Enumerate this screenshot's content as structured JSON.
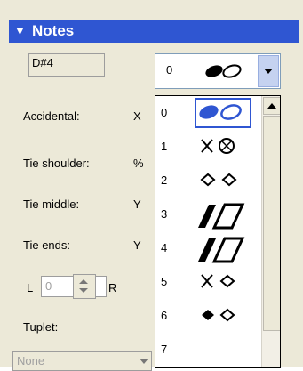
{
  "panel": {
    "title": "Notes",
    "collapse_glyph": "▼"
  },
  "note_value": "D#4",
  "labels": {
    "accidental": "Accidental:",
    "accidental_val": "X",
    "tie_shoulder": "Tie shoulder:",
    "tie_shoulder_val": "%",
    "tie_middle": "Tie middle:",
    "tie_middle_val": "Y",
    "tie_ends": "Tie ends:",
    "tie_ends_val": "Y",
    "l": "L",
    "r": "R",
    "tuplet": "Tuplet:"
  },
  "spin_value": "0",
  "tuplet_select": "None",
  "dropdown": {
    "selected_value": "0",
    "icon": "notehead-pair-icon"
  },
  "list_items": [
    {
      "n": "0",
      "icon": "filled-hollow-oval-icon"
    },
    {
      "n": "1",
      "icon": "x-and-circle-x-icon"
    },
    {
      "n": "2",
      "icon": "diamond-pair-icon"
    },
    {
      "n": "3",
      "icon": "slash-notehead-icon"
    },
    {
      "n": "4",
      "icon": "slash-notehead-icon"
    },
    {
      "n": "5",
      "icon": "x-and-diamond-icon"
    },
    {
      "n": "6",
      "icon": "filled-diamond-and-diamond-icon"
    },
    {
      "n": "7",
      "icon": ""
    }
  ],
  "colors": {
    "header": "#2f56d2",
    "selection": "#2f56d2",
    "panel": "#ece9d8"
  }
}
